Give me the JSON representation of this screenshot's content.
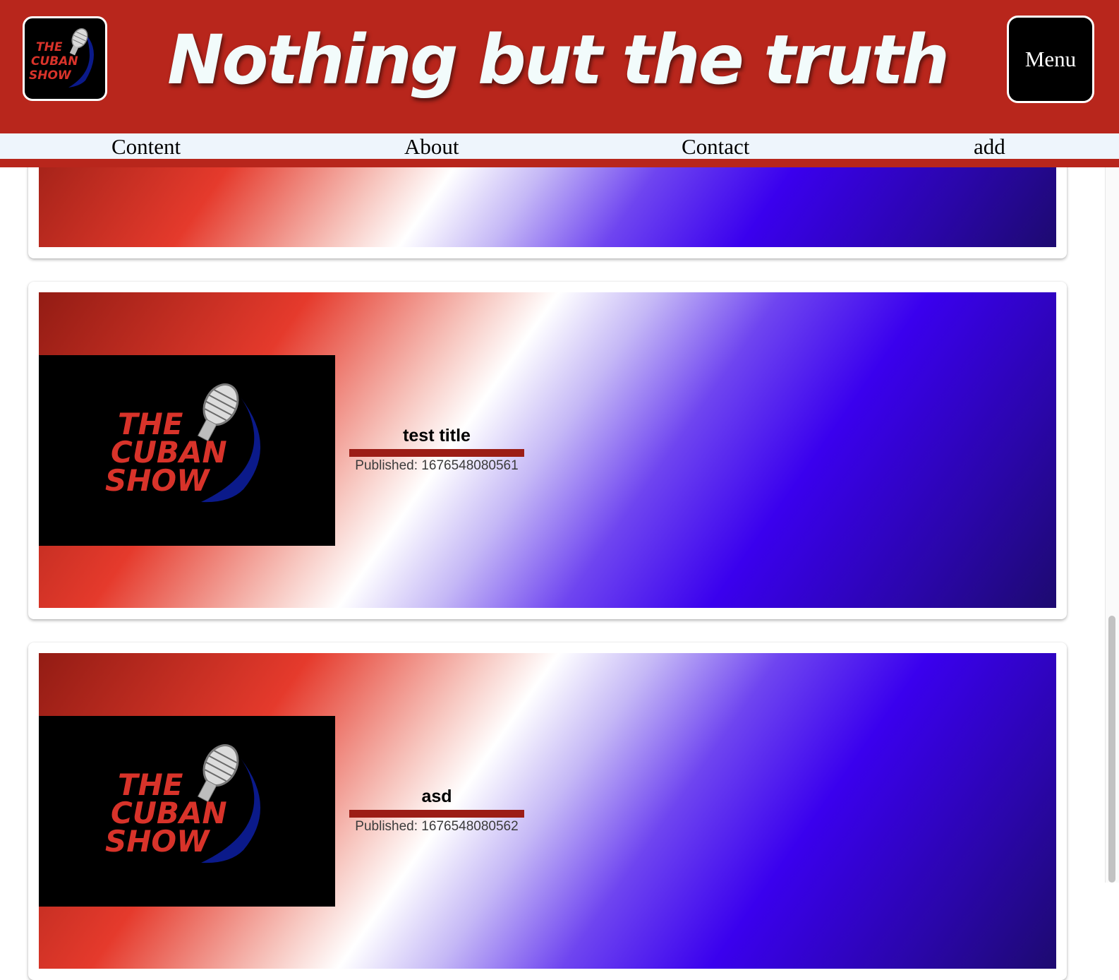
{
  "header": {
    "title": "Nothing but the truth",
    "menu_label": "Menu",
    "logo_text": [
      "THE",
      "CUBAN",
      "SHOW"
    ]
  },
  "nav": {
    "items": [
      "Content",
      "About",
      "Contact",
      "add"
    ]
  },
  "posts": [
    {
      "title": "test title",
      "published": "Published: 1676548080561",
      "thumbnail_text": [
        "THE",
        "CUBAN",
        "SHOW"
      ]
    },
    {
      "title": "asd",
      "published": "Published: 1676548080562",
      "thumbnail_text": [
        "THE",
        "CUBAN",
        "SHOW"
      ]
    }
  ],
  "colors": {
    "header_bg": "#b8261c",
    "nav_bg": "#eef5fc",
    "title_text": "#f2fbfb",
    "accent_bar": "#9c1d16",
    "gradient": [
      "#931c14",
      "#e53a2c",
      "#ffffff",
      "#3a00ee",
      "#1d0a70"
    ]
  },
  "icons": {
    "logo": "microphone-icon"
  }
}
